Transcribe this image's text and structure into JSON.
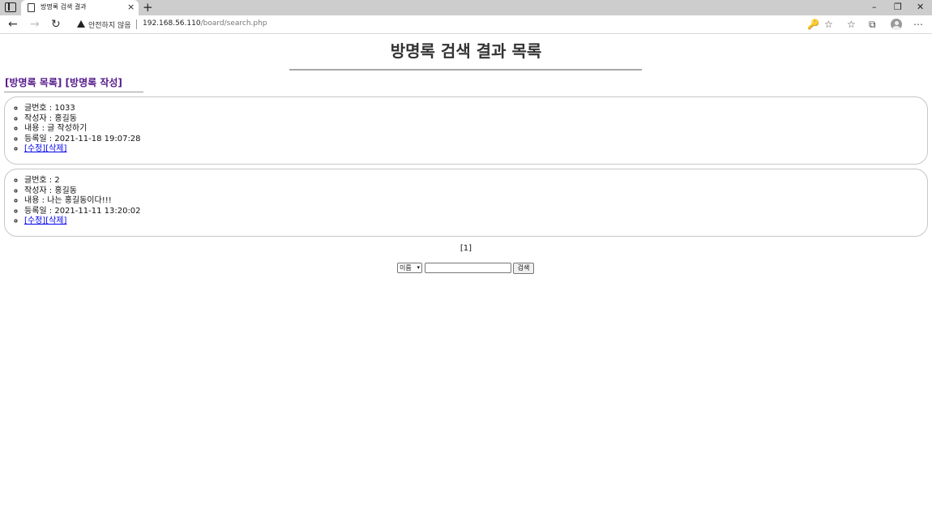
{
  "browser": {
    "tab_title": "방명록 검색 결과",
    "tab_close": "×",
    "new_tab": "+",
    "security_warning": "안전하지 않음",
    "url_host": "192.168.56.110",
    "url_path": "/board/search.php",
    "window_controls": {
      "minimize": "–",
      "maximize": "❐",
      "close": "✕"
    },
    "toolbar_icons": [
      "read-aloud-icon",
      "favorite-add-icon",
      "favorites-icon",
      "collections-icon",
      "profile-icon",
      "more-icon"
    ]
  },
  "page": {
    "title": "방명록 검색 결과 목록",
    "nav": {
      "list_link": "[방명록 목록]",
      "write_link": "[방명록 작성]"
    },
    "posts": [
      {
        "number": "글번호 : 1033",
        "author": "작성자 : 홍길동",
        "content": "내용 : 글 작성하기",
        "date": "등록일 : 2021-11-18 19:07:28",
        "edit": "[수정]",
        "delete": "[삭제]"
      },
      {
        "number": "글번호 : 2",
        "author": "작성자 : 홍길동",
        "content": "내용 : 나는 홍길동이다!!!",
        "date": "등록일 : 2021-11-11 13:20:02",
        "edit": "[수정]",
        "delete": "[삭제]"
      }
    ],
    "pagination": "[1]",
    "search": {
      "select_value": "이름",
      "input_value": "",
      "button_label": "검색"
    }
  }
}
